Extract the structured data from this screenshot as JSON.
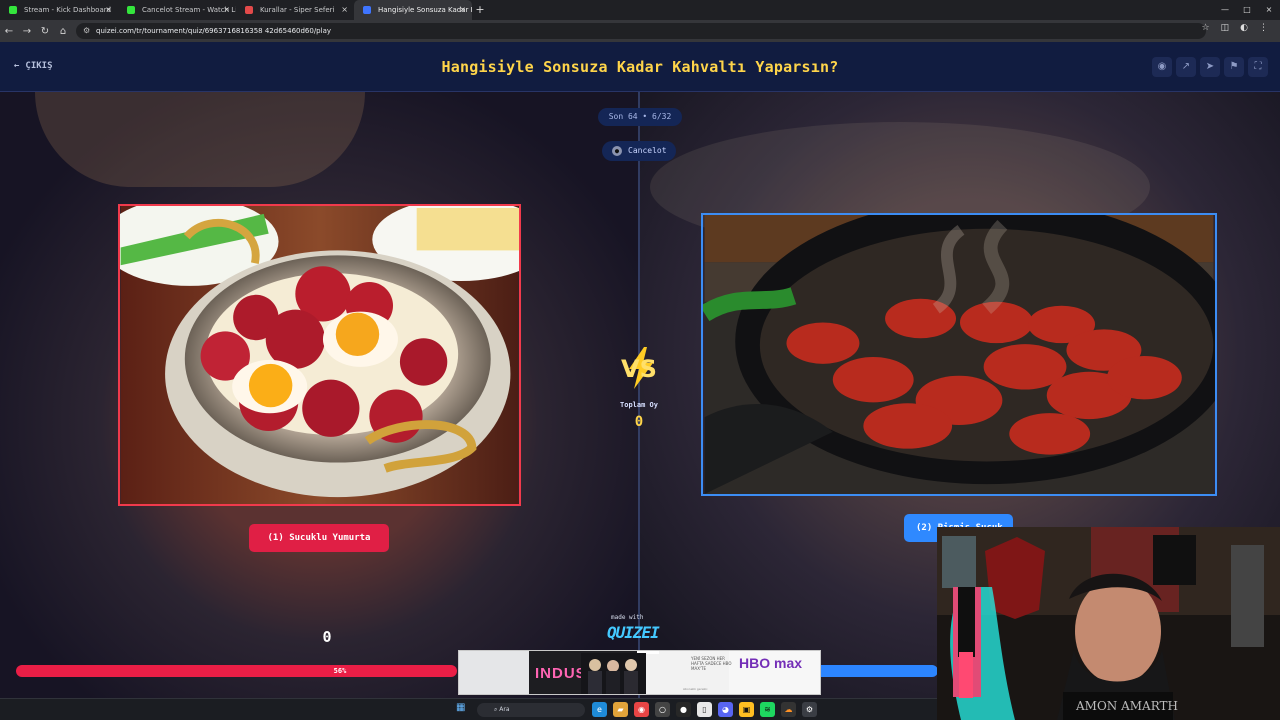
{
  "browser": {
    "tabs": [
      {
        "title": "Stream - Kick Dashboard",
        "active": false,
        "favicon_color": "#34e53d"
      },
      {
        "title": "Cancelot Stream - Watch Live o",
        "active": false,
        "favicon_color": "#34e53d"
      },
      {
        "title": "Kurallar - Siper Seferi",
        "active": false,
        "favicon_color": "#e34a4a"
      },
      {
        "title": "Hangisiyle Sonsuza Kadar Kahv",
        "active": true,
        "favicon_color": "#3f75ff"
      }
    ],
    "new_tab": "+",
    "url": "quizei.com/tr/tournament/quiz/6963716816358 42d65460d60/play"
  },
  "header": {
    "exit": "ÇIKIŞ",
    "title": "Hangisiyle Sonsuza Kadar Kahvaltı Yaparsın?"
  },
  "game": {
    "round": "Son 64 • 6/32",
    "user": "Cancelot",
    "left_choice": "(1) Sucuklu Yumurta",
    "right_choice": "(2) Pişmiş Sucuk",
    "total_label": "Toplam Oy",
    "total_votes": "0",
    "left_votes": "0",
    "progress_label": "56%",
    "progress_left": 0.56,
    "made_with": "made with",
    "brand": "QUIZEI"
  },
  "ad": {
    "industry": "INDUSTRY",
    "hbo": "HBO max",
    "small": "YENİ SEZON\nHER HAFTA\nSADECE HBO MAX'TE",
    "bottom": "Abonelik gerekir."
  },
  "taskbar": {
    "search": "Ara"
  }
}
